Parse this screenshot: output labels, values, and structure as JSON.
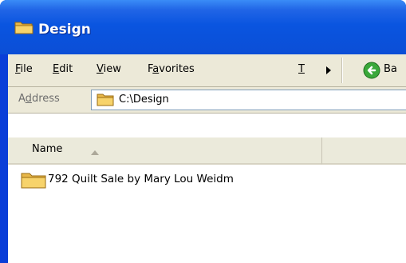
{
  "window": {
    "title": "Design"
  },
  "menu": {
    "items": [
      {
        "accel": "F",
        "rest": "ile"
      },
      {
        "accel": "E",
        "rest": "dit"
      },
      {
        "accel": "V",
        "rest": "iew"
      },
      {
        "pre": "F",
        "accel": "a",
        "rest": "vorites"
      },
      {
        "accel": "T",
        "rest": ""
      }
    ]
  },
  "toolbar": {
    "back_label": "Ba"
  },
  "address": {
    "label_pre": "A",
    "label_accel": "d",
    "label_rest": "dress",
    "value": "C:\\Design"
  },
  "list": {
    "columns": [
      {
        "name": "Name"
      }
    ],
    "items": [
      {
        "name": "792 Quilt Sale by Mary Lou Weidm",
        "icon": "folder-icon"
      }
    ]
  },
  "colors": {
    "titlebar": "#0a55e0",
    "chrome": "#ece9d8",
    "back_button": "#3aa83a"
  }
}
